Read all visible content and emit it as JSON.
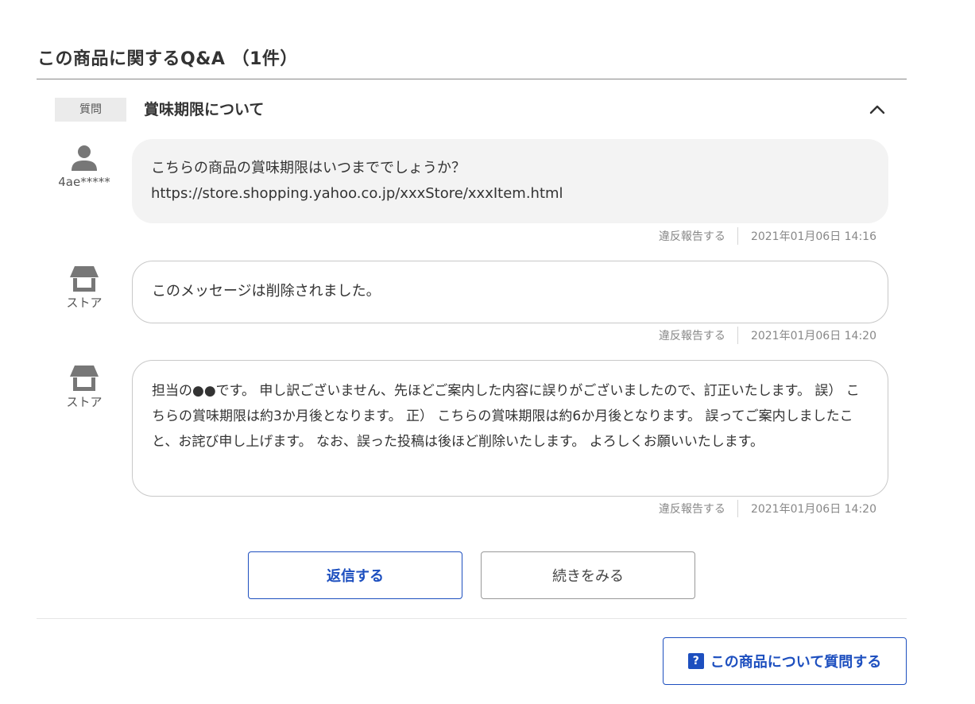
{
  "section": {
    "title": "この商品に関するQ&A （1件）"
  },
  "question": {
    "badge": "質問",
    "title": "賞味期限について"
  },
  "messages": [
    {
      "author": "4ae*****",
      "body": "こちらの商品の賞味期限はいつまででしょうか？ https://store.shopping.yahoo.co.jp/xxxStore/xxxItem.html",
      "report": "違反報告する",
      "date": "2021年01月06日 14:16"
    },
    {
      "author": "ストア",
      "body": "このメッセージは削除されました。",
      "report": "違反報告する",
      "date": "2021年01月06日 14:20"
    },
    {
      "author": "ストア",
      "body": "担当の●●です。 申し訳ございません、先ほどご案内した内容に誤りがございましたので、訂正いたします。 誤） こちらの賞味期限は約3か月後となります。 正） こちらの賞味期限は約6か月後となります。 誤ってご案内しましたこと、お詫び申し上げます。 なお、誤った投稿は後ほど削除いたします。 よろしくお願いいたします。",
      "report": "違反報告する",
      "date": "2021年01月06日 14:20"
    }
  ],
  "actions": {
    "reply": "返信する",
    "more": "続きをみる",
    "ask": "この商品について質問する"
  },
  "icons": {
    "collapse": "chevron-up-icon",
    "user": "user-icon",
    "store": "store-icon",
    "ask": "question-icon"
  },
  "colors": {
    "accent": "#1d4fbf",
    "icon_gray": "#777777"
  }
}
